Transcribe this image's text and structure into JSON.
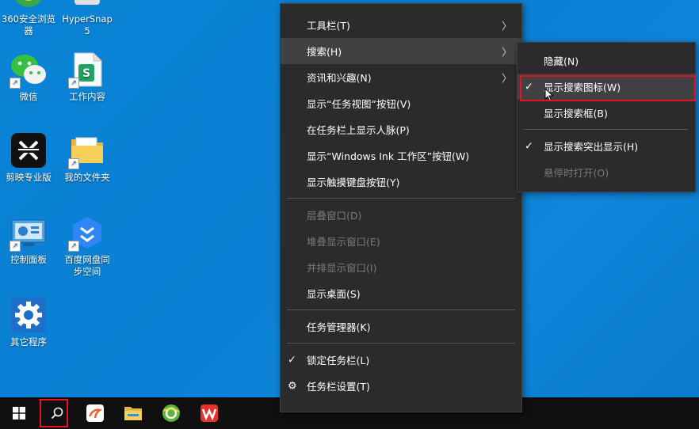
{
  "desktop": {
    "icons": [
      {
        "label": "360安全浏览\n器",
        "name": "360-browser"
      },
      {
        "label": "HyperSnap\n5",
        "name": "hypersnap"
      },
      {
        "label": "微信",
        "name": "wechat"
      },
      {
        "label": "工作内容",
        "name": "work-content"
      },
      {
        "label": "剪映专业版",
        "name": "jianying"
      },
      {
        "label": "我的文件夹",
        "name": "my-folder"
      },
      {
        "label": "控制面板",
        "name": "control-panel"
      },
      {
        "label": "百度网盘同\n步空间",
        "name": "baidu-netdisk"
      },
      {
        "label": "其它程序",
        "name": "other-programs"
      }
    ]
  },
  "context_menu": {
    "items": [
      {
        "label": "工具栏(T)",
        "submenu": true
      },
      {
        "label": "搜索(H)",
        "submenu": true
      },
      {
        "label": "资讯和兴趣(N)",
        "submenu": true
      },
      {
        "label": "显示“任务视图”按钮(V)"
      },
      {
        "label": "在任务栏上显示人脉(P)"
      },
      {
        "label": "显示“Windows Ink 工作区”按钮(W)"
      },
      {
        "label": "显示触摸键盘按钮(Y)"
      },
      {
        "label": "层叠窗口(D)",
        "disabled": true
      },
      {
        "label": "堆叠显示窗口(E)",
        "disabled": true
      },
      {
        "label": "并排显示窗口(I)",
        "disabled": true
      },
      {
        "label": "显示桌面(S)"
      },
      {
        "label": "任务管理器(K)"
      },
      {
        "label": "锁定任务栏(L)",
        "checked": true
      },
      {
        "label": "任务栏设置(T)",
        "icon": "gear-icon"
      }
    ]
  },
  "search_submenu": {
    "items": [
      {
        "label": "隐藏(N)"
      },
      {
        "label": "显示搜索图标(W)",
        "checked": true
      },
      {
        "label": "显示搜索框(B)"
      },
      {
        "label": "显示搜索突出显示(H)",
        "checked": true
      },
      {
        "label": "悬停时打开(O)",
        "disabled": true
      }
    ]
  },
  "colors": {
    "desktop": "#0b7fd3",
    "menu_bg": "#2b2b2b",
    "highlight_red": "#e81123"
  }
}
